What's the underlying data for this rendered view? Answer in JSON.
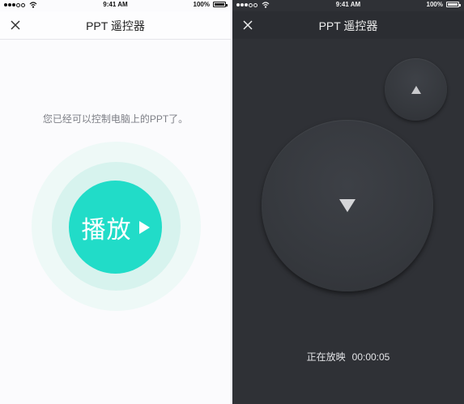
{
  "left_screen": {
    "statusbar": {
      "time": "9:41 AM",
      "battery": "100%"
    },
    "nav": {
      "title": "PPT 遥控器",
      "close_icon": "close-icon"
    },
    "hint": "您已经可以控制电脑上的PPT了。",
    "play_button": {
      "label": "播放",
      "icon": "play-icon"
    }
  },
  "right_screen": {
    "statusbar": {
      "time": "9:41 AM",
      "battery": "100%"
    },
    "nav": {
      "title": "PPT 遥控器",
      "close_icon": "close-icon"
    },
    "prev_button": {
      "icon": "triangle-up-icon"
    },
    "next_button": {
      "icon": "triangle-down-icon"
    },
    "status": {
      "label": "正在放映",
      "elapsed": "00:00:05"
    }
  },
  "colors": {
    "accent": "#21dcc8",
    "ring_outer": "#eef9f7",
    "ring_inner": "#d7f3ee",
    "dark_bg": "#2f3136",
    "light_bg": "#fbfbfd"
  }
}
